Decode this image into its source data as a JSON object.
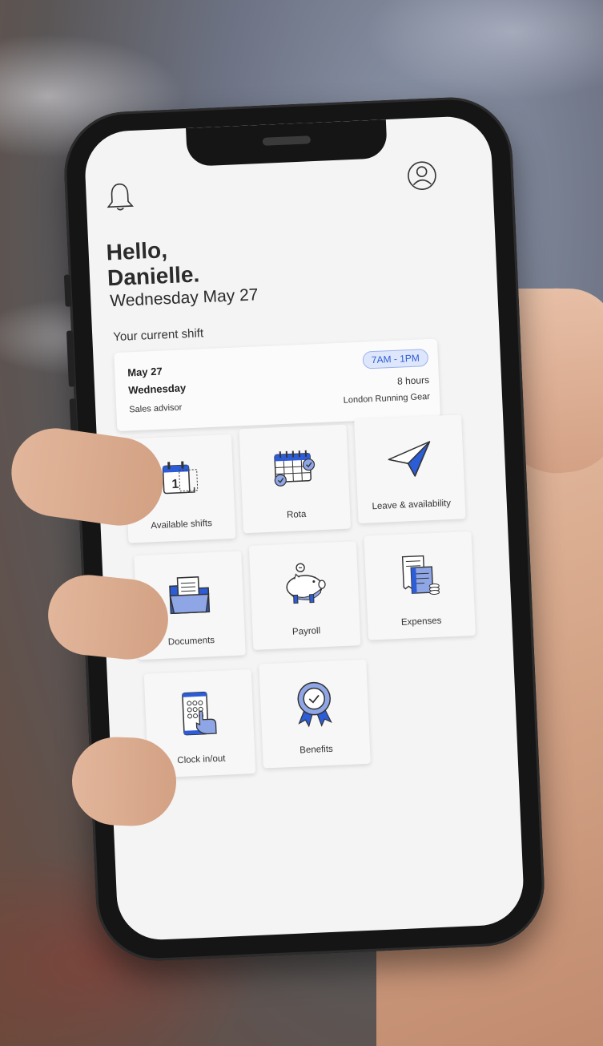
{
  "header": {
    "greeting": "Hello,",
    "name": "Danielle.",
    "date": "Wednesday May 27"
  },
  "shift": {
    "section_label": "Your current shift",
    "date": "May 27",
    "day": "Wednesday",
    "role": "Sales advisor",
    "time": "7AM - 1PM",
    "hours": "8 hours",
    "location": "London Running Gear"
  },
  "tiles": [
    {
      "label": "Available shifts",
      "icon": "calendar-shifts-icon"
    },
    {
      "label": "Rota",
      "icon": "rota-calendar-icon"
    },
    {
      "label": "Leave & availability",
      "icon": "paper-plane-icon"
    },
    {
      "label": "Documents",
      "icon": "folder-documents-icon"
    },
    {
      "label": "Payroll",
      "icon": "piggy-bank-icon"
    },
    {
      "label": "Expenses",
      "icon": "receipt-icon"
    },
    {
      "label": "Clock in/out",
      "icon": "keypad-icon"
    },
    {
      "label": "Benefits",
      "icon": "award-badge-icon"
    }
  ],
  "colors": {
    "accent": "#2c5cd6",
    "accent_light": "#8fa6e6",
    "screen_bg": "#f4f4f4"
  }
}
